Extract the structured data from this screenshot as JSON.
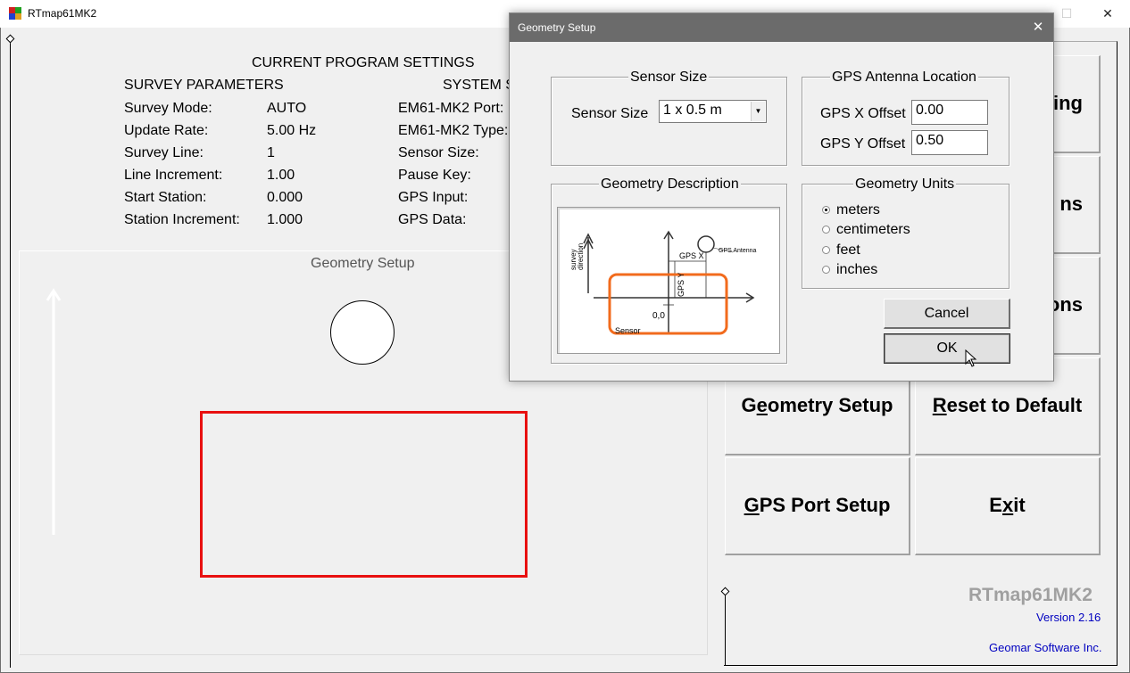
{
  "window": {
    "title": "RTmap61MK2",
    "minimize_glyph": "—",
    "maximize_glyph": "☐",
    "close_glyph": "✕"
  },
  "settings": {
    "heading": "CURRENT PROGRAM SETTINGS",
    "survey_title": "SURVEY PARAMETERS",
    "system_title": "SYSTEM S",
    "survey_rows": [
      {
        "label": "Survey Mode:",
        "value": "AUTO"
      },
      {
        "label": "Update Rate:",
        "value": "5.00 Hz"
      },
      {
        "label": "Survey Line:",
        "value": "1"
      },
      {
        "label": "Line Increment:",
        "value": "1.00"
      },
      {
        "label": "Start Station:",
        "value": "0.000"
      },
      {
        "label": "Station Increment:",
        "value": "1.000"
      }
    ],
    "system_rows": [
      {
        "label": "EM61-MK2 Port:"
      },
      {
        "label": "EM61-MK2 Type:"
      },
      {
        "label": "Sensor Size:"
      },
      {
        "label": "Pause Key:"
      },
      {
        "label": "GPS Input:"
      },
      {
        "label": "GPS Data:"
      }
    ]
  },
  "geometry_panel": {
    "title": "Geometry Setup",
    "sensor_color": "#e81010"
  },
  "buttons": {
    "monitoring_partial": "ring",
    "options_partial": "ns",
    "options2_partial": "ons",
    "geometry_setup": {
      "pre": "G",
      "ul": "e",
      "post": "ometry Setup"
    },
    "reset_default": {
      "pre": "",
      "ul": "R",
      "post": "eset to Default"
    },
    "gps_port_setup": {
      "pre": "",
      "ul": "G",
      "post": "PS Port Setup"
    },
    "exit": {
      "pre": "E",
      "ul": "x",
      "post": "it"
    }
  },
  "footer": {
    "product": "RTmap61MK2",
    "version": "Version 2.16",
    "company": "Geomar Software Inc.",
    "link_color": "#0000c0"
  },
  "dialog": {
    "title": "Geometry Setup",
    "close_glyph": "✕",
    "sensor_size_group": "Sensor Size",
    "sensor_size_label": "Sensor Size",
    "sensor_size_value": "1 x 0.5 m",
    "gps_group": "GPS Antenna Location",
    "gps_x_label": "GPS X Offset",
    "gps_x_value": "0.00",
    "gps_y_label": "GPS Y Offset",
    "gps_y_value": "0.50",
    "desc_group": "Geometry Description",
    "units_group": "Geometry Units",
    "units": [
      {
        "label": "meters",
        "selected": true
      },
      {
        "label": "centimeters",
        "selected": false
      },
      {
        "label": "feet",
        "selected": false
      },
      {
        "label": "inches",
        "selected": false
      }
    ],
    "cancel_label": "Cancel",
    "ok_label": "OK",
    "diagram": {
      "survey_label_1": "survey",
      "survey_label_2": "direction",
      "gps_x": "GPS X",
      "gps_y": "GPS Y",
      "gps_antenna": "GPS Antenna",
      "origin": "0,0",
      "sensor": "Sensor",
      "sensor_color": "#f26b1d"
    }
  }
}
